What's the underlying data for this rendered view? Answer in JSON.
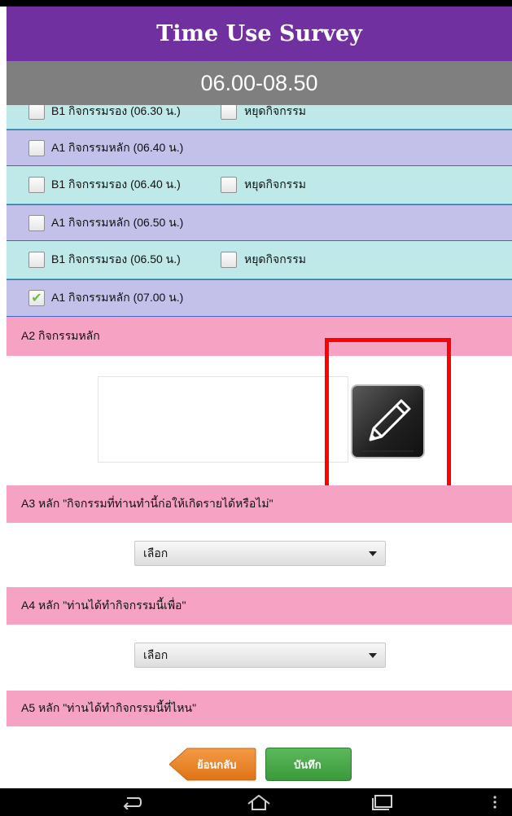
{
  "header": {
    "title": "Time Use Survey",
    "time_range": "06.00-08.50"
  },
  "rows": [
    {
      "kind": "secondary",
      "label": "B1 กิจกรรมรอง (06.30 น.)",
      "stop_label": "หยุดกิจกรรม",
      "checked": false
    },
    {
      "kind": "main",
      "label": "A1 กิจกรรมหลัก (06.40 น.)",
      "checked": false
    },
    {
      "kind": "secondary",
      "label": "B1 กิจกรรมรอง (06.40 น.)",
      "stop_label": "หยุดกิจกรรม",
      "checked": false
    },
    {
      "kind": "main",
      "label": "A1 กิจกรรมหลัก (06.50 น.)",
      "checked": false
    },
    {
      "kind": "secondary",
      "label": "B1 กิจกรรมรอง (06.50 น.)",
      "stop_label": "หยุดกิจกรรม",
      "checked": false
    },
    {
      "kind": "main",
      "label": "A1 กิจกรรมหลัก (07.00 น.)",
      "checked": true
    }
  ],
  "sections": {
    "a2": {
      "label": "A2 กิจกรรมหลัก",
      "text_value": ""
    },
    "a3": {
      "label": "A3 หลัก  \"กิจกรรมที่ท่านทำนี้ก่อให้เกิดรายได้หรือไม่\"",
      "select_value": "เลือก"
    },
    "a4": {
      "label": "A4 หลัก  \"ท่านได้ทำกิจกรรมนี้เพื่อ\"",
      "select_value": "เลือก"
    },
    "a5": {
      "label": "A5 หลัก  \"ท่านได้ทำกิจกรรมนี้ที่ไหน\""
    }
  },
  "buttons": {
    "back_label": "ย้อนกลับ",
    "save_label": "บันทึก"
  },
  "icons": {
    "edit": "pencil-icon",
    "check": "checkmark-icon",
    "nav_back": "back-icon",
    "nav_home": "home-icon",
    "nav_recent": "recent-apps-icon",
    "nav_menu": "overflow-menu-icon"
  },
  "colors": {
    "title_bg": "#7030a0",
    "time_bg": "#7f7f7f",
    "main_row_bg": "#c3c0ea",
    "secondary_row_bg": "#bfe9e9",
    "section_bg": "#f6a2c3",
    "back_button": "#e8822a",
    "save_button": "#4cae4c",
    "highlight": "#ff0000"
  }
}
